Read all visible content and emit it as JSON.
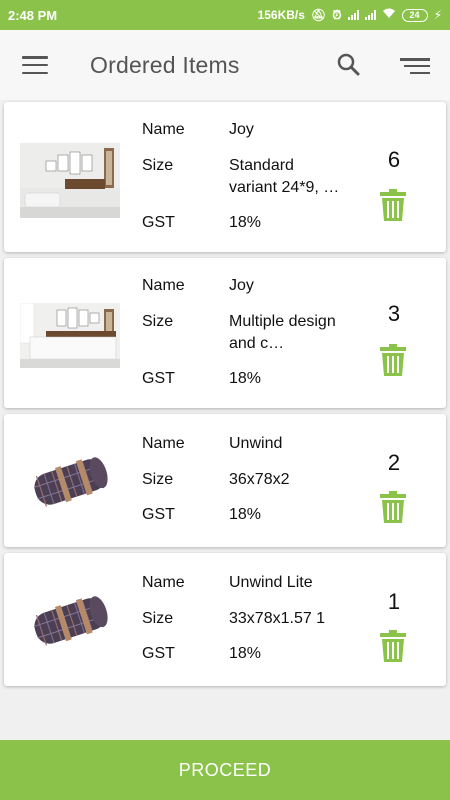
{
  "status_bar": {
    "time": "2:48 PM",
    "net_speed": "156KB/s",
    "battery": "24"
  },
  "app_bar": {
    "title": "Ordered Items",
    "menu_icon": "hamburger-menu-icon",
    "search_icon": "search-icon",
    "sort_icon": "sort-icon"
  },
  "field_labels": {
    "name": "Name",
    "size": "Size",
    "gst": "GST"
  },
  "items": [
    {
      "name": "Joy",
      "size": "Standard variant 24*9, …",
      "gst": "18%",
      "quantity": "6",
      "image": "wall-art-room-photo"
    },
    {
      "name": "Joy",
      "size": "Multiple design and c…",
      "gst": "18%",
      "quantity": "3",
      "image": "wall-art-bedroom-photo"
    },
    {
      "name": "Unwind",
      "size": "36x78x2",
      "gst": "18%",
      "quantity": "2",
      "image": "rolled-mat-photo"
    },
    {
      "name": "Unwind Lite",
      "size": "33x78x1.57 1",
      "gst": "18%",
      "quantity": "1",
      "image": "rolled-mat-photo"
    }
  ],
  "footer": {
    "proceed_label": "PROCEED"
  },
  "colors": {
    "accent": "#8bc34a",
    "trash": "#8bc34a",
    "text": "#111111"
  }
}
